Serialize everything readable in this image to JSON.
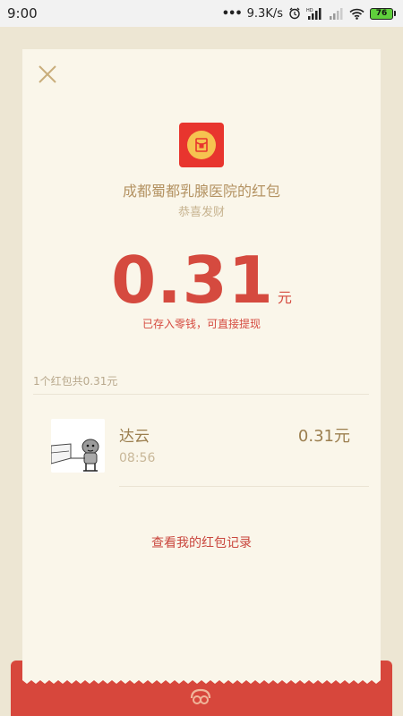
{
  "status_bar": {
    "time": "9:00",
    "network_speed": "9.3K/s",
    "battery_level": "76"
  },
  "packet": {
    "sender_title": "成都蜀都乳腺医院的红包",
    "greeting": "恭喜发财",
    "amount": "0.31",
    "amount_unit": "元",
    "deposit_note": "已存入零钱，可直接提现"
  },
  "summary": "1个红包共0.31元",
  "records": [
    {
      "name": "达云",
      "time": "08:56",
      "amount": "0.31元"
    }
  ],
  "history_link": "查看我的红包记录",
  "colors": {
    "accent_red": "#d54a3f",
    "gold": "#b49363",
    "card_bg": "#faf6ea",
    "page_bg": "#ede6d3"
  }
}
